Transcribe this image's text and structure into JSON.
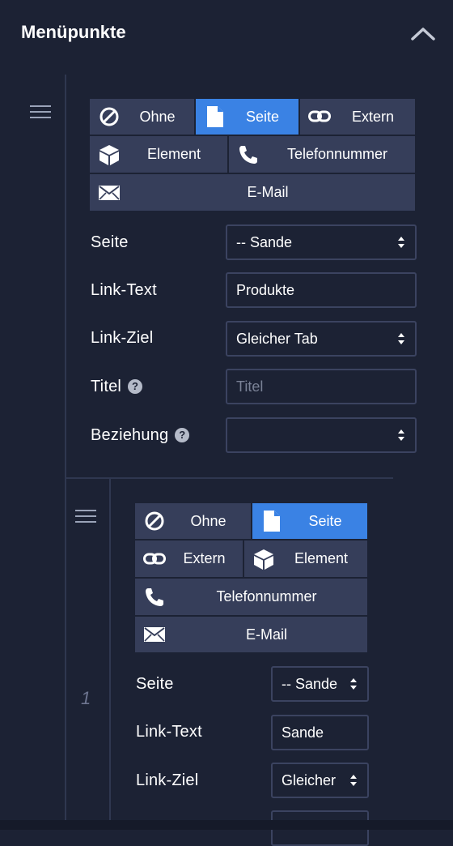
{
  "header": {
    "title": "Menüpunkte"
  },
  "item1": {
    "type_buttons": {
      "none": "Ohne",
      "page": "Seite",
      "external": "Extern",
      "element": "Element",
      "phone": "Telefonnummer",
      "email": "E-Mail"
    },
    "active_type": "Seite",
    "fields": {
      "page_label": "Seite",
      "page_value": "-- Sande",
      "link_text_label": "Link-Text",
      "link_text_value": "Produkte",
      "link_target_label": "Link-Ziel",
      "link_target_value": "Gleicher Tab",
      "title_label": "Titel",
      "title_placeholder": "Titel",
      "relation_label": "Beziehung",
      "relation_value": ""
    }
  },
  "item2": {
    "index": "1",
    "type_buttons": {
      "none": "Ohne",
      "page": "Seite",
      "external": "Extern",
      "element": "Element",
      "phone": "Telefonnummer",
      "email": "E-Mail"
    },
    "active_type": "Seite",
    "fields": {
      "page_label": "Seite",
      "page_value": "-- Sande",
      "link_text_label": "Link-Text",
      "link_text_value": "Sande",
      "link_target_label": "Link-Ziel",
      "link_target_value": "Gleicher"
    }
  },
  "colors": {
    "background": "#1c2234",
    "button": "#363e5a",
    "accent": "#3a82e4",
    "border": "#3b4360"
  }
}
